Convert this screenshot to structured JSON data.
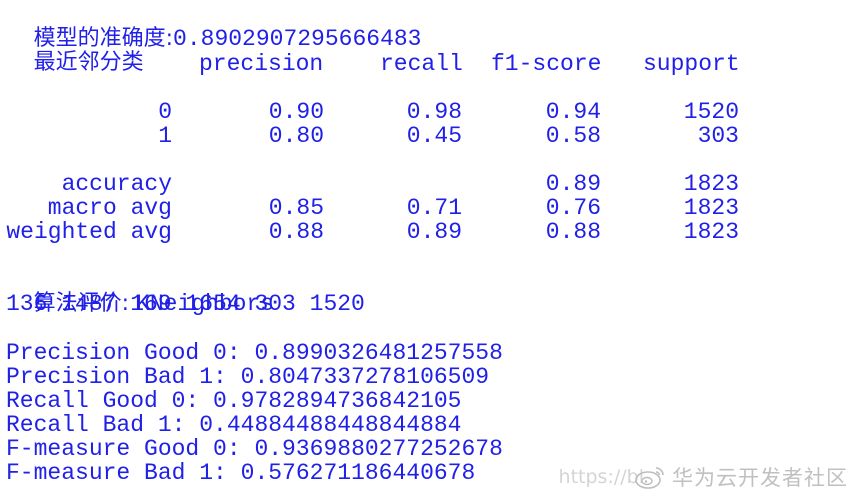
{
  "header": {
    "accuracy_label": "模型的准确度:",
    "accuracy_value": "0.8902907295666483",
    "classifier_name": "最近邻分类"
  },
  "report": {
    "columns": [
      "precision",
      "recall",
      "f1-score",
      "support"
    ],
    "rows": [
      {
        "label": "0",
        "precision": "0.90",
        "recall": "0.98",
        "f1": "0.94",
        "support": "1520"
      },
      {
        "label": "1",
        "precision": "0.80",
        "recall": "0.45",
        "f1": "0.58",
        "support": "303"
      }
    ],
    "summary": [
      {
        "label": "accuracy",
        "precision": "",
        "recall": "",
        "f1": "0.89",
        "support": "1823"
      },
      {
        "label": "macro avg",
        "precision": "0.85",
        "recall": "0.71",
        "f1": "0.76",
        "support": "1823"
      },
      {
        "label": "weighted avg",
        "precision": "0.88",
        "recall": "0.89",
        "f1": "0.88",
        "support": "1823"
      }
    ]
  },
  "evaluation": {
    "title_label": "算法评价: ",
    "title_value": "KNeighbors",
    "counts": "136 1487 169 1654 303 1520"
  },
  "metrics": [
    {
      "label": "Precision Good 0: ",
      "value": "0.8990326481257558"
    },
    {
      "label": "Precision Bad 1: ",
      "value": "0.8047337278106509"
    },
    {
      "label": "Recall Good 0: ",
      "value": "0.9782894736842105"
    },
    {
      "label": "Recall Bad 1: ",
      "value": "0.44884488448844884"
    },
    {
      "label": "F-measure Good 0: ",
      "value": "0.9369880277252678"
    },
    {
      "label": "F-measure Bad 1: ",
      "value": "0.576271186440678"
    }
  ],
  "watermark": {
    "url": "https://bl",
    "icon": "weibo-icon",
    "brand": "华为云开发者社区"
  }
}
